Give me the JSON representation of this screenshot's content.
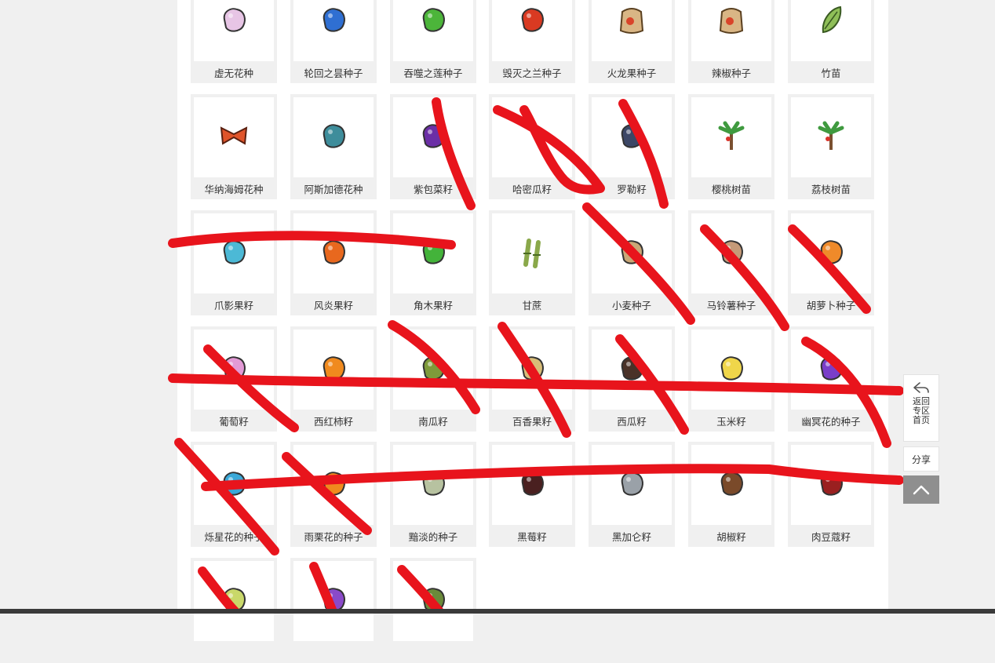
{
  "items": [
    {
      "name": "虚无花种",
      "color": "#e7c5e5",
      "shape": "blob",
      "icon": "void-flower-seed-icon"
    },
    {
      "name": "轮回之昙种子",
      "color": "#2f6fd2",
      "shape": "blob",
      "icon": "samsara-epiphyllum-seed-icon"
    },
    {
      "name": "吞噬之莲种子",
      "color": "#4cb53a",
      "shape": "blob",
      "icon": "devouring-lotus-seed-icon"
    },
    {
      "name": "毁灭之兰种子",
      "color": "#d93a22",
      "shape": "blob",
      "icon": "destruction-orchid-seed-icon"
    },
    {
      "name": "火龙果种子",
      "color": "#d9b685",
      "shape": "bag",
      "icon": "seed-bag-icon"
    },
    {
      "name": "辣椒种子",
      "color": "#d9b685",
      "shape": "bag",
      "icon": "seed-bag-icon"
    },
    {
      "name": "竹苗",
      "color": "#8fbf58",
      "shape": "leaf",
      "icon": "bamboo-shoot-icon"
    },
    {
      "name": "华纳海姆花种",
      "color": "#e0542a",
      "shape": "bow",
      "icon": "vanaheim-flower-seed-icon"
    },
    {
      "name": "阿斯加德花种",
      "color": "#3e8d9b",
      "shape": "blob",
      "icon": "asgard-flower-seed-icon"
    },
    {
      "name": "紫包菜籽",
      "color": "#6b2fa6",
      "shape": "blob",
      "icon": "purple-cabbage-seed-icon"
    },
    {
      "name": "哈密瓜籽",
      "color": "#cfcfcf",
      "shape": "none",
      "icon": "hami-melon-seed-icon"
    },
    {
      "name": "罗勒籽",
      "color": "#3c4766",
      "shape": "blob",
      "icon": "basil-seed-icon"
    },
    {
      "name": "樱桃树苗",
      "color": "#3f9a3f",
      "shape": "tree",
      "icon": "cherry-sapling-icon"
    },
    {
      "name": "荔枝树苗",
      "color": "#3f9a3f",
      "shape": "tree",
      "icon": "lychee-sapling-icon"
    },
    {
      "name": "爪影果籽",
      "color": "#4cb9d6",
      "shape": "blob",
      "icon": "claw-shadow-fruit-seed-icon"
    },
    {
      "name": "风炎果籽",
      "color": "#e8681e",
      "shape": "blob",
      "icon": "wind-flame-fruit-seed-icon"
    },
    {
      "name": "角木果籽",
      "color": "#43b33a",
      "shape": "blob",
      "icon": "horn-wood-fruit-seed-icon"
    },
    {
      "name": "甘蔗",
      "color": "#8aa84a",
      "shape": "cane",
      "icon": "sugarcane-icon"
    },
    {
      "name": "小麦种子",
      "color": "#c9a777",
      "shape": "blob",
      "icon": "wheat-seed-icon"
    },
    {
      "name": "马铃薯种子",
      "color": "#c59a78",
      "shape": "blob",
      "icon": "potato-seed-icon"
    },
    {
      "name": "胡萝卜种子",
      "color": "#ef8a2a",
      "shape": "blob",
      "icon": "carrot-seed-icon"
    },
    {
      "name": "葡萄籽",
      "color": "#e39ad6",
      "shape": "blob",
      "icon": "grape-seed-icon"
    },
    {
      "name": "西红柿籽",
      "color": "#f08a1e",
      "shape": "blob",
      "icon": "tomato-seed-icon"
    },
    {
      "name": "南瓜籽",
      "color": "#7e9a3a",
      "shape": "blob",
      "icon": "pumpkin-seed-icon"
    },
    {
      "name": "百香果籽",
      "color": "#d9bd78",
      "shape": "blob",
      "icon": "passion-fruit-seed-icon"
    },
    {
      "name": "西瓜籽",
      "color": "#4a3228",
      "shape": "blob",
      "icon": "watermelon-seed-icon"
    },
    {
      "name": "玉米籽",
      "color": "#f0d64a",
      "shape": "blob",
      "icon": "corn-seed-icon"
    },
    {
      "name": "幽冥花的种子",
      "color": "#7a3ec9",
      "shape": "blob",
      "icon": "nether-flower-seed-icon"
    },
    {
      "name": "烁星花的种子",
      "color": "#3aa8d8",
      "shape": "blob",
      "icon": "twinkle-star-flower-seed-icon"
    },
    {
      "name": "雨栗花的种子",
      "color": "#f08a1e",
      "shape": "blob",
      "icon": "rain-chestnut-flower-seed-icon"
    },
    {
      "name": "黯淡的种子",
      "color": "#b7c2a0",
      "shape": "blob",
      "icon": "dim-seed-icon"
    },
    {
      "name": "黑莓籽",
      "color": "#4a2020",
      "shape": "blob",
      "icon": "blackberry-seed-icon"
    },
    {
      "name": "黑加仑籽",
      "color": "#9aa1a8",
      "shape": "blob",
      "icon": "blackcurrant-seed-icon"
    },
    {
      "name": "胡椒籽",
      "color": "#7a4a2a",
      "shape": "blob",
      "icon": "pepper-seed-icon"
    },
    {
      "name": "肉豆蔻籽",
      "color": "#9a2020",
      "shape": "blob",
      "icon": "nutmeg-seed-icon"
    },
    {
      "name": "",
      "color": "#c9d86a",
      "shape": "blob",
      "icon": "seed-icon"
    },
    {
      "name": "",
      "color": "#8a4ac9",
      "shape": "blob",
      "icon": "seed-icon"
    },
    {
      "name": "",
      "color": "#6a8a3a",
      "shape": "blob",
      "icon": "seed-icon"
    }
  ],
  "sidebar": {
    "back_home_lines": [
      "返回",
      "专区",
      "首页"
    ],
    "share_label": "分享",
    "to_top_icon": "chevron-up-icon",
    "back_icon": "reply-arrow-icon"
  },
  "colors": {
    "scribble": "#e8141c",
    "card_bg": "#f0f0f0",
    "page_bg": "#f0f0f0"
  }
}
